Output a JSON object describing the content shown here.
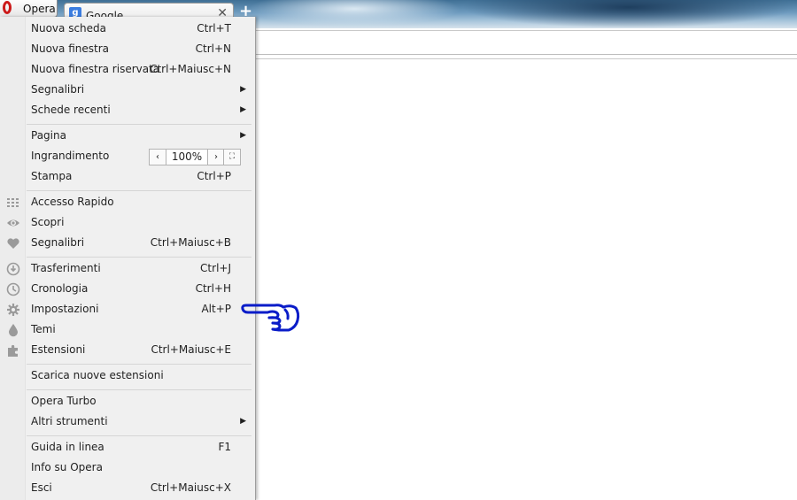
{
  "browser": {
    "menu_button_label": "Opera",
    "tab": {
      "favicon": "g-favicon-icon",
      "title": "Google"
    }
  },
  "menu": {
    "new_tab": {
      "label": "Nuova scheda",
      "shortcut": "Ctrl+T"
    },
    "new_window": {
      "label": "Nuova finestra",
      "shortcut": "Ctrl+N"
    },
    "new_private_window": {
      "label": "Nuova finestra riservata",
      "shortcut": "Ctrl+Maiusc+N"
    },
    "bookmarks_sub": {
      "label": "Segnalibri"
    },
    "recent_tabs": {
      "label": "Schede recenti"
    },
    "page": {
      "label": "Pagina"
    },
    "zoom": {
      "label": "Ingrandimento",
      "value": "100%",
      "dec": "‹",
      "inc": "›",
      "full": "⛶"
    },
    "print": {
      "label": "Stampa",
      "shortcut": "Ctrl+P"
    },
    "speed_dial": {
      "label": "Accesso Rapido",
      "icon": "grid-icon"
    },
    "discover": {
      "label": "Scopri",
      "icon": "eye-icon"
    },
    "bookmarks": {
      "label": "Segnalibri",
      "shortcut": "Ctrl+Maiusc+B",
      "icon": "heart-icon"
    },
    "downloads": {
      "label": "Trasferimenti",
      "shortcut": "Ctrl+J",
      "icon": "download-icon"
    },
    "history": {
      "label": "Cronologia",
      "shortcut": "Ctrl+H",
      "icon": "clock-icon"
    },
    "settings": {
      "label": "Impostazioni",
      "shortcut": "Alt+P",
      "icon": "gear-icon"
    },
    "themes": {
      "label": "Temi",
      "icon": "drop-icon"
    },
    "extensions": {
      "label": "Estensioni",
      "shortcut": "Ctrl+Maiusc+E",
      "icon": "puzzle-icon"
    },
    "get_extensions": {
      "label": "Scarica nuove estensioni"
    },
    "turbo": {
      "label": "Opera Turbo"
    },
    "more_tools": {
      "label": "Altri strumenti"
    },
    "help": {
      "label": "Guida in linea",
      "shortcut": "F1"
    },
    "about": {
      "label": "Info su Opera"
    },
    "exit": {
      "label": "Esci",
      "shortcut": "Ctrl+Maiusc+X"
    }
  },
  "annotation": {
    "icon": "pointing-hand-icon",
    "color": "#0a1cc8"
  }
}
